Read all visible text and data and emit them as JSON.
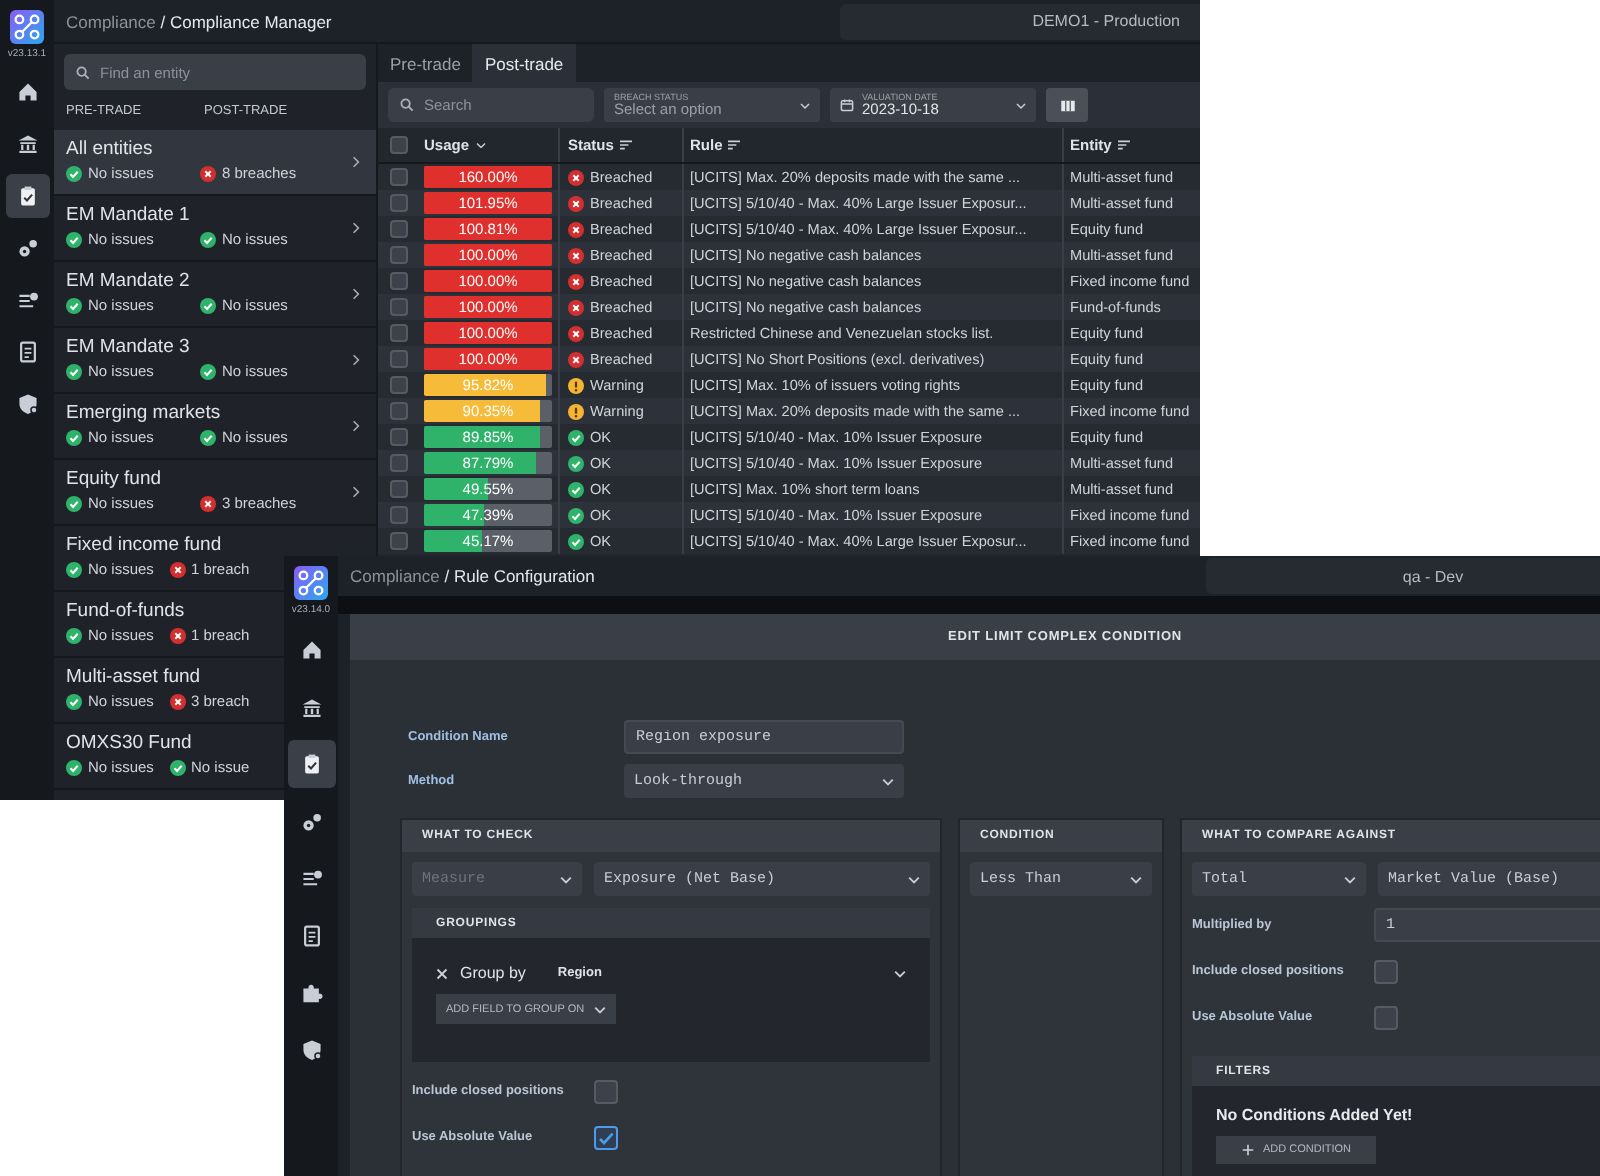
{
  "back_window": {
    "app_version": "v23.13.1",
    "sidebar_items": [
      {
        "selected": false
      },
      {
        "selected": false
      },
      {
        "selected": true
      },
      {
        "selected": false
      },
      {
        "selected": false
      },
      {
        "selected": false
      },
      {
        "selected": false
      }
    ],
    "breadcrumb": {
      "section": "Compliance",
      "separator": "/",
      "page": "Compliance Manager"
    },
    "environment": "DEMO1 - Production",
    "entity_panel": {
      "search": {
        "placeholder": "Find an entity"
      },
      "columns": [
        "PRE-TRADE",
        "POST-TRADE"
      ],
      "entities": [
        {
          "name": "All entities",
          "selected": true,
          "pre_trade": {
            "kind": "ok",
            "text": "No issues"
          },
          "post_trade": {
            "kind": "breach",
            "text": "8 breaches"
          }
        },
        {
          "name": "EM Mandate 1",
          "selected": false,
          "pre_trade": {
            "kind": "ok",
            "text": "No issues"
          },
          "post_trade": {
            "kind": "ok",
            "text": "No issues"
          }
        },
        {
          "name": "EM Mandate 2",
          "selected": false,
          "pre_trade": {
            "kind": "ok",
            "text": "No issues"
          },
          "post_trade": {
            "kind": "ok",
            "text": "No issues"
          }
        },
        {
          "name": "EM Mandate 3",
          "selected": false,
          "pre_trade": {
            "kind": "ok",
            "text": "No issues"
          },
          "post_trade": {
            "kind": "ok",
            "text": "No issues"
          }
        },
        {
          "name": "Emerging markets",
          "selected": false,
          "pre_trade": {
            "kind": "ok",
            "text": "No issues"
          },
          "post_trade": {
            "kind": "ok",
            "text": "No issues"
          }
        },
        {
          "name": "Equity fund",
          "selected": false,
          "pre_trade": {
            "kind": "ok",
            "text": "No issues"
          },
          "post_trade": {
            "kind": "breach",
            "text": "3 breaches"
          }
        },
        {
          "name": "Fixed income fund",
          "selected": false,
          "pre_trade": {
            "kind": "ok",
            "text": "No issues"
          },
          "post_trade": {
            "kind": "breach",
            "text": "1 breach"
          }
        },
        {
          "name": "Fund-of-funds",
          "selected": false,
          "pre_trade": {
            "kind": "ok",
            "text": "No issues"
          },
          "post_trade": {
            "kind": "breach",
            "text": "1 breach"
          }
        },
        {
          "name": "Multi-asset fund",
          "selected": false,
          "pre_trade": {
            "kind": "ok",
            "text": "No issues"
          },
          "post_trade": {
            "kind": "breach",
            "text": "3 breach"
          }
        },
        {
          "name": "OMXS30 Fund",
          "selected": false,
          "pre_trade": {
            "kind": "ok",
            "text": "No issues"
          },
          "post_trade": {
            "kind": "ok",
            "text": "No issue"
          }
        }
      ]
    },
    "tabs": [
      {
        "label": "Pre-trade",
        "selected": false
      },
      {
        "label": "Post-trade",
        "selected": true
      }
    ],
    "filters": {
      "search": {
        "placeholder": "Search"
      },
      "breach_status": {
        "label": "BREACH STATUS",
        "placeholder": "Select an option"
      },
      "valuation_date": {
        "label": "VALUATION DATE",
        "value": "2023-10-18"
      }
    },
    "table": {
      "select_all": {
        "checked": false
      },
      "columns": [
        "Usage",
        "Status",
        "Rule",
        "Entity"
      ],
      "rows": [
        {
          "checked": false,
          "usage": "160.00%",
          "level": 1,
          "status": {
            "kind": "breached",
            "text": "Breached"
          },
          "rule": "[UCITS] Max. 20% deposits made with the same ...",
          "entity": "Multi-asset fund"
        },
        {
          "checked": false,
          "usage": "101.95%",
          "level": 1,
          "status": {
            "kind": "breached",
            "text": "Breached"
          },
          "rule": "[UCITS] 5/10/40 - Max. 40% Large Issuer Exposur...",
          "entity": "Multi-asset fund"
        },
        {
          "checked": false,
          "usage": "100.81%",
          "level": 1,
          "status": {
            "kind": "breached",
            "text": "Breached"
          },
          "rule": "[UCITS] 5/10/40 - Max. 40% Large Issuer Exposur...",
          "entity": "Equity fund"
        },
        {
          "checked": false,
          "usage": "100.00%",
          "level": 1,
          "status": {
            "kind": "breached",
            "text": "Breached"
          },
          "rule": "[UCITS] No negative cash balances",
          "entity": "Multi-asset fund"
        },
        {
          "checked": false,
          "usage": "100.00%",
          "level": 1,
          "status": {
            "kind": "breached",
            "text": "Breached"
          },
          "rule": "[UCITS] No negative cash balances",
          "entity": "Fixed income fund"
        },
        {
          "checked": false,
          "usage": "100.00%",
          "level": 1,
          "status": {
            "kind": "breached",
            "text": "Breached"
          },
          "rule": "[UCITS] No negative cash balances",
          "entity": "Fund-of-funds"
        },
        {
          "checked": false,
          "usage": "100.00%",
          "level": 1,
          "status": {
            "kind": "breached",
            "text": "Breached"
          },
          "rule": "Restricted Chinese and Venezuelan stocks list.",
          "entity": "Equity fund"
        },
        {
          "checked": false,
          "usage": "100.00%",
          "level": 1,
          "status": {
            "kind": "breached",
            "text": "Breached"
          },
          "rule": "[UCITS] No Short Positions (excl. derivatives)",
          "entity": "Equity fund"
        },
        {
          "checked": false,
          "usage": "95.82%",
          "level": 0.9582,
          "status": {
            "kind": "warning",
            "text": "Warning"
          },
          "rule": "[UCITS] Max. 10% of issuers voting rights",
          "entity": "Equity fund"
        },
        {
          "checked": false,
          "usage": "90.35%",
          "level": 0.9035,
          "status": {
            "kind": "warning",
            "text": "Warning"
          },
          "rule": "[UCITS] Max. 20% deposits made with the same ...",
          "entity": "Fixed income fund"
        },
        {
          "checked": false,
          "usage": "89.85%",
          "level": 0.8985,
          "status": {
            "kind": "ok",
            "text": "OK"
          },
          "rule": "[UCITS] 5/10/40 - Max. 10% Issuer Exposure",
          "entity": "Equity fund"
        },
        {
          "checked": false,
          "usage": "87.79%",
          "level": 0.8779,
          "status": {
            "kind": "ok",
            "text": "OK"
          },
          "rule": "[UCITS] 5/10/40 - Max. 10% Issuer Exposure",
          "entity": "Multi-asset fund"
        },
        {
          "checked": false,
          "usage": "49.55%",
          "level": 0.4955,
          "status": {
            "kind": "ok",
            "text": "OK"
          },
          "rule": "[UCITS] Max. 10% short term loans",
          "entity": "Multi-asset fund"
        },
        {
          "checked": false,
          "usage": "47.39%",
          "level": 0.4739,
          "status": {
            "kind": "ok",
            "text": "OK"
          },
          "rule": "[UCITS] 5/10/40 - Max. 10% Issuer Exposure",
          "entity": "Fixed income fund"
        },
        {
          "checked": false,
          "usage": "45.17%",
          "level": 0.4517,
          "status": {
            "kind": "ok",
            "text": "OK"
          },
          "rule": "[UCITS] 5/10/40 - Max. 40% Large Issuer Exposur...",
          "entity": "Fixed income fund"
        }
      ]
    }
  },
  "front_window": {
    "app_version": "v23.14.0",
    "sidebar_items": [
      {
        "selected": false
      },
      {
        "selected": false
      },
      {
        "selected": true
      },
      {
        "selected": false
      },
      {
        "selected": false
      },
      {
        "selected": false
      },
      {
        "selected": false
      },
      {
        "selected": false
      }
    ],
    "breadcrumb": {
      "section": "Compliance",
      "separator": "/",
      "page": "Rule Configuration"
    },
    "environment": "qa - Dev",
    "dialog": {
      "title": "EDIT LIMIT COMPLEX CONDITION",
      "condition_name": {
        "label": "Condition Name",
        "value": "Region exposure"
      },
      "method": {
        "label": "Method",
        "value": "Look-through"
      },
      "what_to_check": {
        "title": "WHAT TO CHECK",
        "measure": {
          "placeholder": "Measure"
        },
        "measure_value": "Exposure (Net Base)",
        "groupings": {
          "title": "GROUPINGS",
          "group_by": {
            "label": "Group by",
            "value": "Region"
          },
          "add_field": "ADD FIELD TO GROUP ON"
        },
        "include_closed_positions": {
          "label": "Include closed positions",
          "checked": false
        },
        "use_absolute_value": {
          "label": "Use Absolute Value",
          "checked": true
        }
      },
      "condition": {
        "title": "CONDITION",
        "value": "Less Than"
      },
      "compare_against": {
        "title": "WHAT TO COMPARE AGAINST",
        "aggregate": "Total",
        "measure": "Market Value (Base)",
        "multiplied_by": {
          "label": "Multiplied by",
          "value": "1"
        },
        "include_closed_positions": {
          "label": "Include closed positions",
          "checked": false
        },
        "use_absolute_value": {
          "label": "Use Absolute Value",
          "checked": false
        },
        "filters": {
          "title": "FILTERS",
          "empty_message": "No Conditions Added Yet!",
          "add_button": "ADD CONDITION"
        }
      }
    }
  }
}
